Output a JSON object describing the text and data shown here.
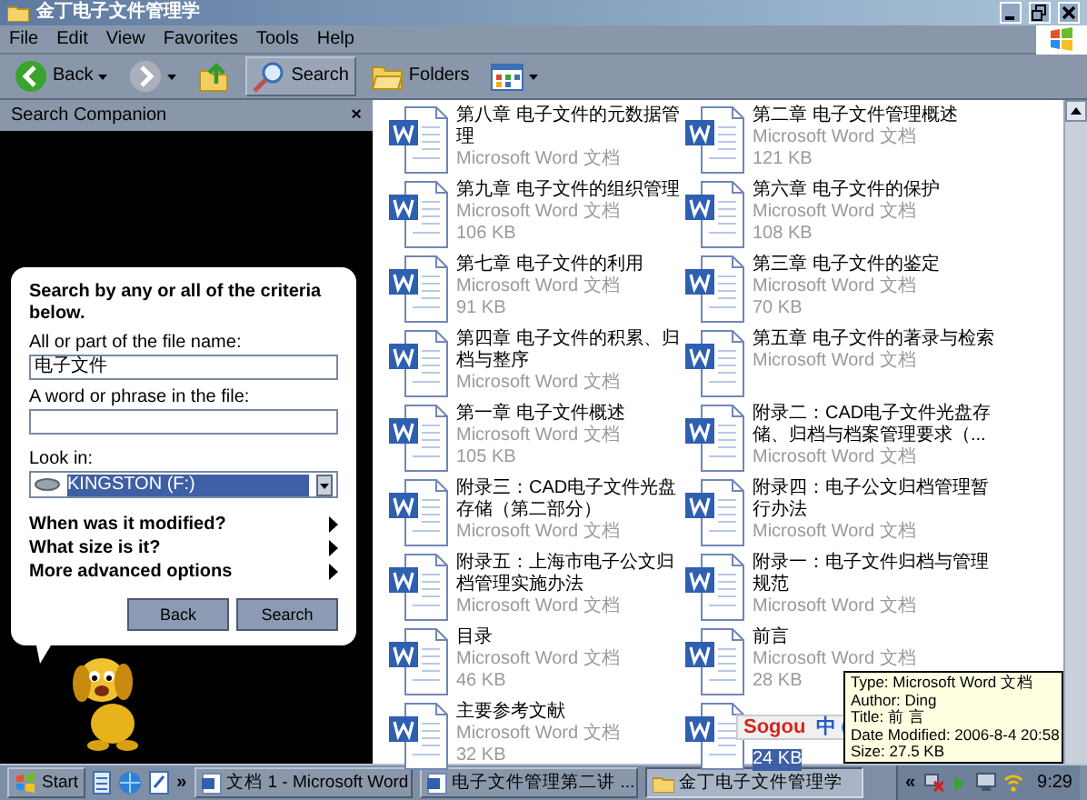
{
  "window": {
    "title": "金丁电子文件管理学"
  },
  "menu": [
    "File",
    "Edit",
    "View",
    "Favorites",
    "Tools",
    "Help"
  ],
  "toolbar": [
    {
      "kind": "back",
      "label": "Back"
    },
    {
      "kind": "forward"
    },
    {
      "kind": "up"
    },
    {
      "kind": "search",
      "label": "Search",
      "selected": true
    },
    {
      "kind": "folders",
      "label": "Folders",
      "selected": false
    },
    {
      "kind": "views"
    }
  ],
  "search_companion": {
    "title": "Search Companion",
    "close": "×",
    "heading": "Search by any or all of the criteria below.",
    "name_label": "All or part of the file name:",
    "name_value": "电子文件",
    "phrase_label": "A word or phrase in the file:",
    "look_in_label": "Look in:",
    "look_in_value": "KINGSTON (F:)",
    "options": [
      "When was it modified?",
      "What size is it?",
      "More advanced options"
    ],
    "buttons": [
      "Back",
      "Search"
    ]
  },
  "files": [
    {
      "name": "第八章  电子文件的元数据管理",
      "type": "Microsoft Word 文档",
      "selected": false
    },
    {
      "name": "第二章  电子文件管理概述",
      "type": "Microsoft Word 文档",
      "size": "121 KB",
      "selected": false
    },
    {
      "name": "第九章 电子文件的组织管理",
      "type": "Microsoft Word 文档",
      "size": "106 KB",
      "selected": false
    },
    {
      "name": "第六章  电子文件的保护",
      "type": "Microsoft Word 文档",
      "size": "108 KB",
      "selected": false
    },
    {
      "name": "第七章  电子文件的利用",
      "type": "Microsoft Word 文档",
      "size": "91 KB",
      "selected": false
    },
    {
      "name": "第三章  电子文件的鉴定",
      "type": "Microsoft Word 文档",
      "size": "70 KB",
      "selected": false
    },
    {
      "name": "第四章  电子文件的积累、归档与整序",
      "type": "Microsoft Word 文档",
      "selected": false
    },
    {
      "name": "第五章  电子文件的著录与检索",
      "type": "Microsoft Word 文档",
      "selected": false
    },
    {
      "name": "第一章    电子文件概述",
      "type": "Microsoft Word 文档",
      "size": "105 KB",
      "selected": false
    },
    {
      "name": "附录二：CAD电子文件光盘存储、归档与档案管理要求（...",
      "type": "Microsoft Word 文档",
      "selected": false
    },
    {
      "name": "附录三：CAD电子文件光盘存储（第二部分）",
      "type": "Microsoft Word 文档",
      "selected": false
    },
    {
      "name": "附录四：电子公文归档管理暂行办法",
      "type": "Microsoft Word 文档",
      "selected": false
    },
    {
      "name": "附录五：上海市电子公文归档管理实施办法",
      "type": "Microsoft Word 文档",
      "selected": false
    },
    {
      "name": "附录一：电子文件归档与管理规范",
      "type": "Microsoft Word 文档",
      "selected": false
    },
    {
      "name": "目录",
      "type": "Microsoft Word 文档",
      "size": "46 KB",
      "selected": false
    },
    {
      "name": "前言",
      "type": "Microsoft Word 文档",
      "size": "28 KB",
      "selected": false
    },
    {
      "name": "主要参考文献",
      "type": "Microsoft Word 文档",
      "size": "32 KB",
      "selected": false
    },
    {
      "size": "24 KB",
      "selected": true
    }
  ],
  "ime_bar": {
    "name": "Sogou",
    "mode": "中"
  },
  "tooltip": [
    "Type: Microsoft Word 文档",
    "Author: Ding",
    "Title: 前  言",
    "Date Modified: 2006-8-4 20:58",
    "Size: 27.5 KB"
  ],
  "taskbar": {
    "start": "Start",
    "more": "»",
    "tasks": [
      {
        "label": "文档 1 - Microsoft Word",
        "selected": false
      },
      {
        "label": "电子文件管理第二讲 ...",
        "selected": false
      },
      {
        "label": "金丁电子文件管理学",
        "selected": true
      }
    ],
    "tray_more": "«",
    "clock": "9:29"
  }
}
